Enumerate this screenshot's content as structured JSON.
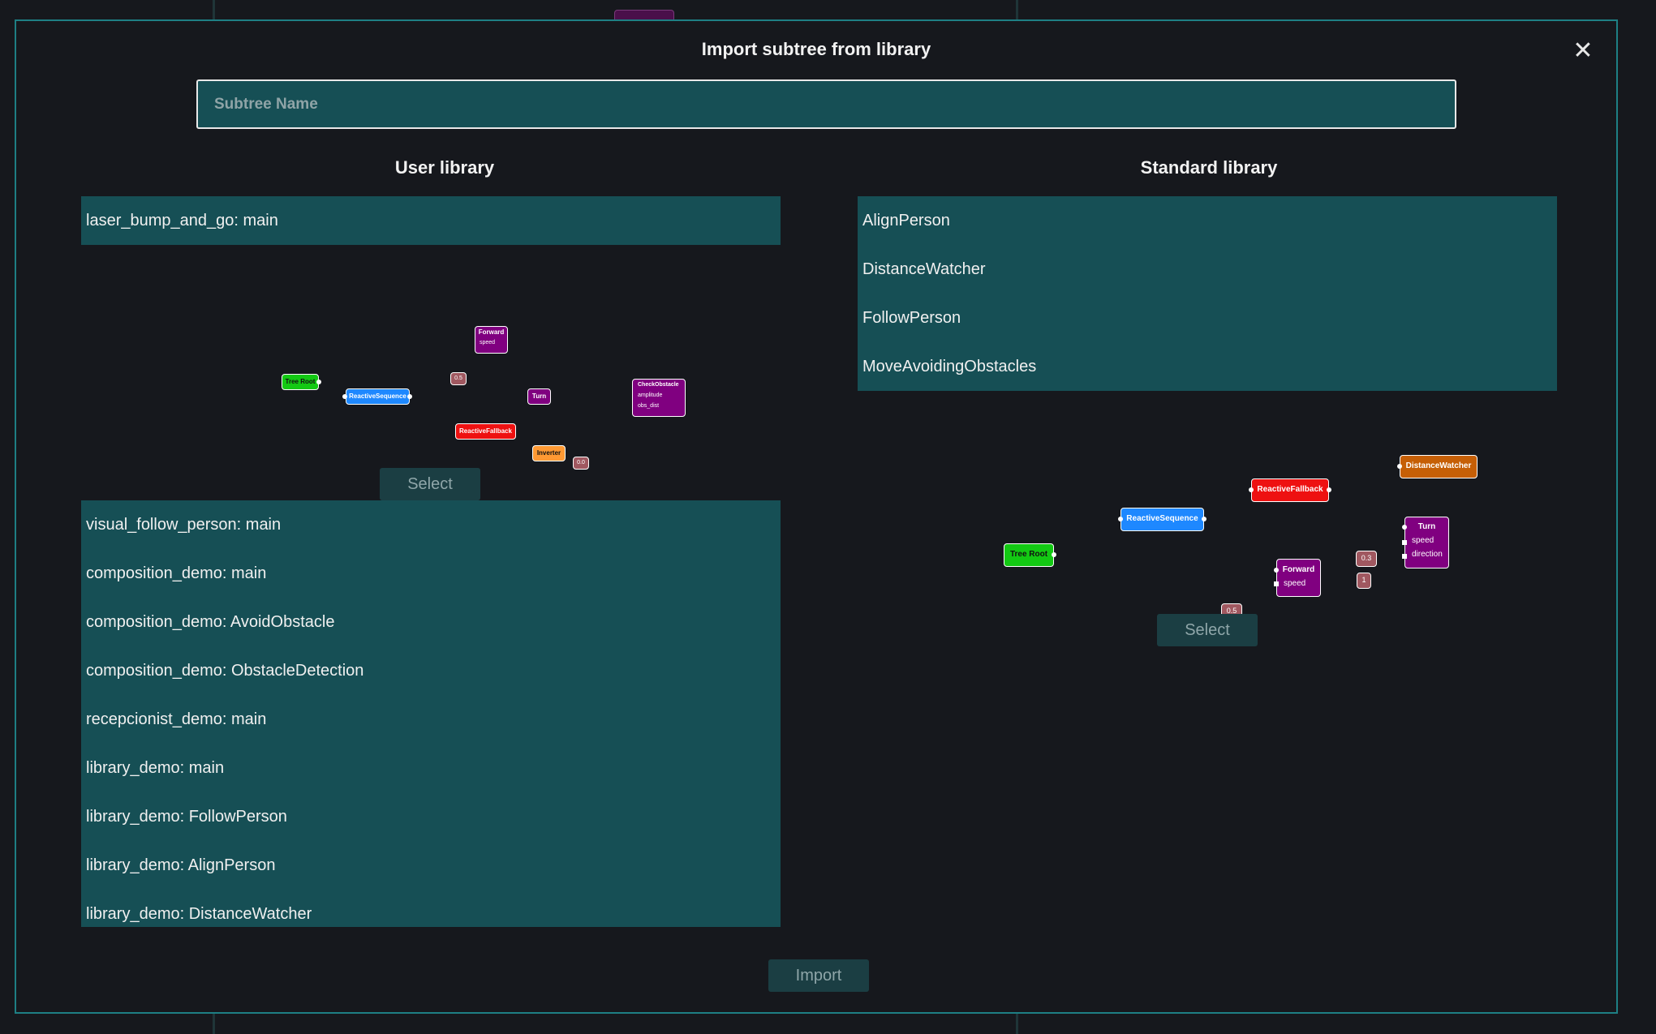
{
  "dialog": {
    "title": "Import subtree from library",
    "close_icon": "close-icon",
    "subtree_name_placeholder": "Subtree Name",
    "import_label": "Import"
  },
  "user_library": {
    "title": "User library",
    "selected": "laser_bump_and_go: main",
    "select_label": "Select",
    "items": [
      "visual_follow_person: main",
      "composition_demo: main",
      "composition_demo: AvoidObstacle",
      "composition_demo: ObstacleDetection",
      "recepcionist_demo: main",
      "library_demo: main",
      "library_demo: FollowPerson",
      "library_demo: AlignPerson",
      "library_demo: DistanceWatcher"
    ],
    "preview": {
      "tree_root": "Tree Root",
      "reactive_sequence": "ReactiveSequence",
      "reactive_fallback": "ReactiveFallback",
      "forward": "Forward",
      "forward_port": "speed",
      "turn": "Turn",
      "check_obstacle": "CheckObstacle",
      "check_ports": [
        "amplitude",
        "obs_dist"
      ],
      "inverter": "Inverter",
      "value_a": "0.5",
      "value_b": "0.0"
    }
  },
  "standard_library": {
    "title": "Standard library",
    "select_label": "Select",
    "items": [
      "AlignPerson",
      "DistanceWatcher",
      "FollowPerson",
      "MoveAvoidingObstacles"
    ],
    "preview": {
      "tree_root": "Tree Root",
      "reactive_sequence": "ReactiveSequence",
      "reactive_fallback": "ReactiveFallback",
      "distance_watcher": "DistanceWatcher",
      "turn": "Turn",
      "turn_ports": [
        "speed",
        "direction"
      ],
      "forward": "Forward",
      "forward_port": "speed",
      "value_a": "0.3",
      "value_b": "1",
      "value_c": "0.5"
    }
  },
  "colors": {
    "accent_border": "#1e7f84",
    "list_bg": "#164f55",
    "tree_root": "#13c913",
    "sequence": "#1e88ff",
    "fallback": "#ee1111",
    "action": "#800080",
    "inverter": "#ff9933",
    "watcher": "#c65f06",
    "value": "#a05860"
  }
}
